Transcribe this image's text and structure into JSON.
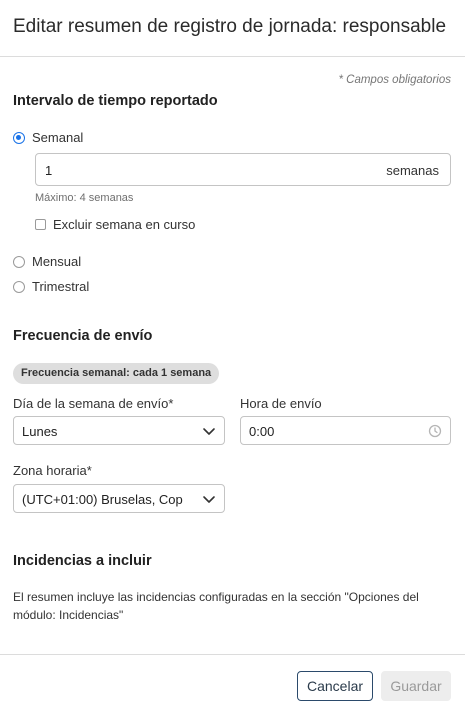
{
  "dialog": {
    "title": "Editar resumen de registro de jornada: responsable",
    "required_note": "* Campos obligatorios"
  },
  "interval": {
    "heading": "Intervalo de tiempo reportado",
    "options": [
      {
        "label": "Semanal",
        "selected": true
      },
      {
        "label": "Mensual",
        "selected": false
      },
      {
        "label": "Trimestral",
        "selected": false
      }
    ],
    "weeks_value": "1",
    "weeks_unit": "semanas",
    "max_hint": "Máximo: 4 semanas",
    "exclude_current_week": {
      "label": "Excluir semana en curso",
      "checked": false
    }
  },
  "frequency": {
    "heading": "Frecuencia de envío",
    "chip": "Frecuencia semanal: cada 1 semana",
    "day_label": "Día de la semana de envío*",
    "day_value": "Lunes",
    "time_label": "Hora de envío",
    "time_value": "0:00",
    "timezone_label": "Zona horaria*",
    "timezone_value": "(UTC+01:00) Bruselas, Cop"
  },
  "incidences": {
    "heading": "Incidencias a incluir",
    "description": "El resumen incluye las incidencias configuradas en la sección \"Opciones del módulo: Incidencias\""
  },
  "footer": {
    "cancel_label": "Cancelar",
    "save_label": "Guardar"
  },
  "colors": {
    "accent": "#1a73e8",
    "cancel_border": "#2b4a6b",
    "disabled_bg": "#ededed"
  }
}
